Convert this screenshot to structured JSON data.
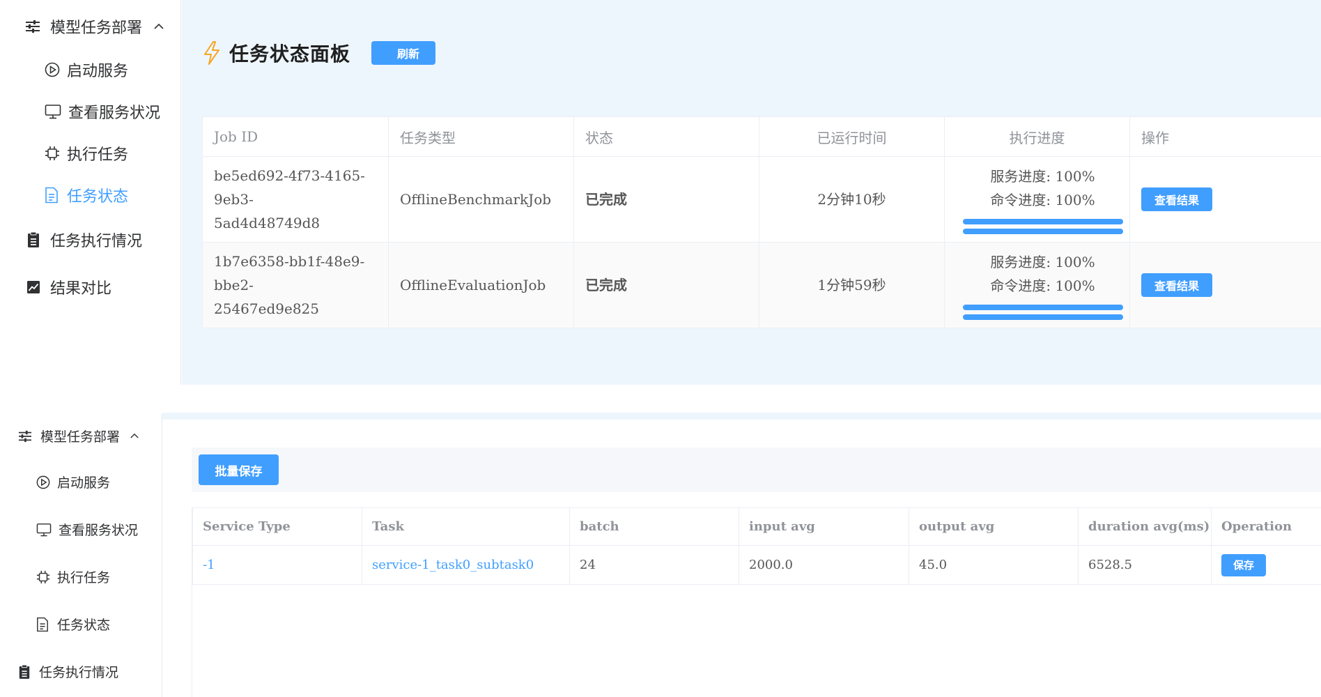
{
  "top": {
    "sidebar": {
      "group_label": "模型任务部署",
      "items": [
        {
          "label": "启动服务",
          "icon": "play-circle-icon"
        },
        {
          "label": "查看服务状况",
          "icon": "monitor-icon"
        },
        {
          "label": "执行任务",
          "icon": "cpu-icon"
        },
        {
          "label": "任务状态",
          "icon": "document-icon",
          "active": true
        }
      ],
      "sections": [
        {
          "label": "任务执行情况",
          "icon": "clipboard-icon"
        },
        {
          "label": "结果对比",
          "icon": "chart-icon"
        }
      ]
    },
    "main": {
      "title": "任务状态面板",
      "refresh_label": "刷新",
      "columns": [
        "Job ID",
        "任务类型",
        "状态",
        "已运行时间",
        "执行进度",
        "操作"
      ],
      "rows": [
        {
          "job_id_line1": "be5ed692-4f73-4165-9eb3-",
          "job_id_line2": "5ad4d48749d8",
          "type": "OfflineBenchmarkJob",
          "status": "已完成",
          "elapsed": "2分钟10秒",
          "service_progress": "服务进度: 100%",
          "command_progress": "命令进度: 100%",
          "service_progress_value": 1.0,
          "command_progress_value": 1.0,
          "action": "查看结果"
        },
        {
          "job_id_line1": "1b7e6358-bb1f-48e9-bbe2-",
          "job_id_line2": "25467ed9e825",
          "type": "OfflineEvaluationJob",
          "status": "已完成",
          "elapsed": "1分钟59秒",
          "service_progress": "服务进度: 100%",
          "command_progress": "命令进度: 100%",
          "service_progress_value": 1.0,
          "command_progress_value": 1.0,
          "action": "查看结果"
        }
      ]
    }
  },
  "bottom": {
    "sidebar": {
      "group_label": "模型任务部署",
      "items": [
        {
          "label": "启动服务",
          "icon": "play-circle-icon"
        },
        {
          "label": "查看服务状况",
          "icon": "monitor-icon"
        },
        {
          "label": "执行任务",
          "icon": "cpu-icon"
        },
        {
          "label": "任务状态",
          "icon": "document-icon"
        }
      ],
      "sections": [
        {
          "label": "任务执行情况",
          "icon": "clipboard-icon"
        }
      ]
    },
    "main": {
      "batch_save_label": "批量保存",
      "columns": [
        "Service Type",
        "Task",
        "batch",
        "input avg",
        "output avg",
        "duration avg(ms)",
        "Operation"
      ],
      "rows": [
        {
          "service_type": "-1",
          "task": "service-1_task0_subtask0",
          "batch": "24",
          "input_avg": "2000.0",
          "output_avg": "45.0",
          "duration_avg": "6528.5",
          "operation": "保存"
        }
      ]
    }
  },
  "colors": {
    "accent": "#409eff",
    "success": "#67c23a",
    "panel_bg": "#eef6fd"
  }
}
